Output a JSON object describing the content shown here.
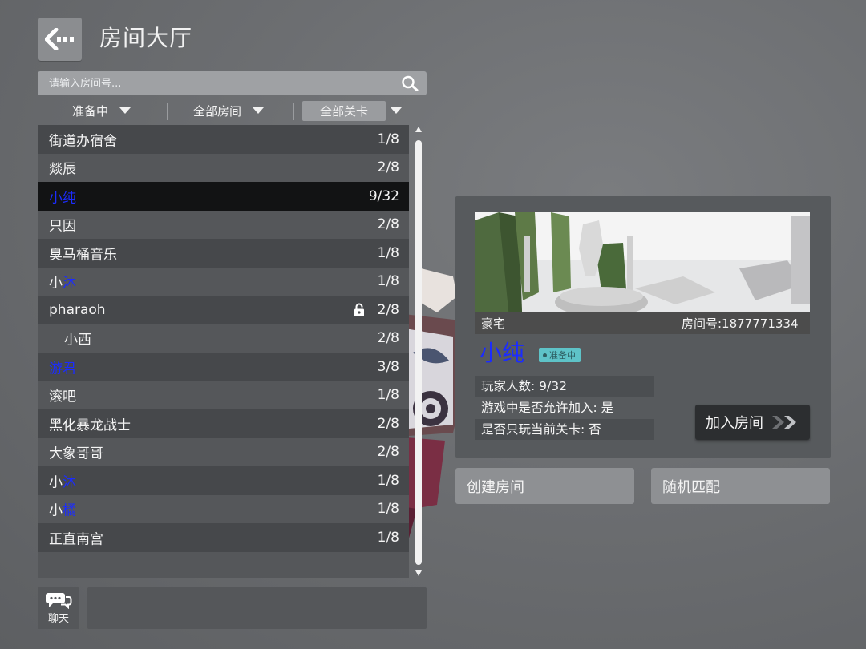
{
  "header": {
    "title": "房间大厅"
  },
  "search": {
    "placeholder": "请输入房间号..."
  },
  "filters": [
    {
      "label": "准备中"
    },
    {
      "label": "全部房间"
    },
    {
      "label": "全部关卡"
    }
  ],
  "rooms": [
    {
      "name": "街道办宿舍",
      "count": "1/8"
    },
    {
      "name": "燚辰",
      "count": "2/8"
    },
    {
      "name": "小纯",
      "count": "9/32",
      "selected": true
    },
    {
      "name": "只因",
      "count": "2/8"
    },
    {
      "name": "臭马桶音乐",
      "count": "1/8"
    },
    {
      "name_a": "小",
      "name_b": "沐",
      "count": "1/8"
    },
    {
      "name": "pharaoh",
      "count": "2/8",
      "locked": true
    },
    {
      "name": "小西",
      "count": "2/8"
    },
    {
      "name": "游君",
      "count": "3/8"
    },
    {
      "name": "滚吧",
      "count": "1/8"
    },
    {
      "name": "黑化暴龙战士",
      "count": "2/8"
    },
    {
      "name": "大象哥哥",
      "count": "2/8"
    },
    {
      "name_a": "小",
      "name_b": "沐",
      "count": "1/8"
    },
    {
      "name_a": "小",
      "name_b": "橘",
      "count": "1/8"
    },
    {
      "name": "正直南宫",
      "count": "1/8"
    }
  ],
  "chat": {
    "label": "聊天"
  },
  "detail": {
    "map_name": "豪宅",
    "room_id": "房间号:1877771334",
    "host": "小纯",
    "status": "准备中",
    "players": "玩家人数: 9/32",
    "allow_join": "游戏中是否允许加入: 是",
    "current_level_only": "是否只玩当前关卡: 否",
    "join_label": "加入房间"
  },
  "actions": {
    "create_label": "创建房间",
    "random_label": "随机匹配"
  },
  "colors": {
    "background": "#6c6e71",
    "panel": "#55575a",
    "selected_row": "#121314",
    "name_blue": "#1b2cff",
    "status_badge": "#5ec3c8"
  }
}
